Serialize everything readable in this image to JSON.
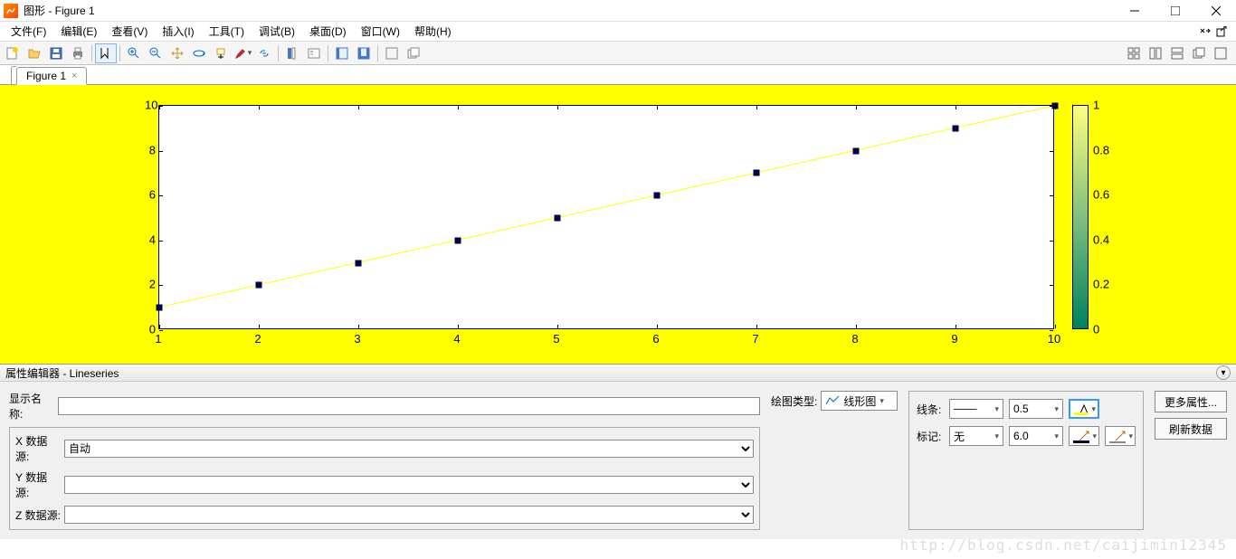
{
  "window": {
    "title": "图形 - Figure 1"
  },
  "menu": {
    "file": "文件(F)",
    "edit": "编辑(E)",
    "view": "查看(V)",
    "insert": "插入(I)",
    "tools": "工具(T)",
    "debug": "调试(B)",
    "desktop": "桌面(D)",
    "window": "窗口(W)",
    "help": "帮助(H)"
  },
  "tab": {
    "label": "Figure 1"
  },
  "prop_editor": {
    "title": "属性编辑器 - Lineseries",
    "display_name_label": "显示名称:",
    "display_name_value": "",
    "x_src_label": "X 数据源:",
    "x_src_value": "自动",
    "y_src_label": "Y 数据源:",
    "y_src_value": "",
    "z_src_label": "Z 数据源:",
    "z_src_value": "",
    "plot_type_label": "绘图类型:",
    "plot_type_value": "线形图",
    "line_label": "线条:",
    "line_style": "———",
    "line_width": "0.5",
    "marker_label": "标记:",
    "marker_style": "无",
    "marker_size": "6.0",
    "more_props": "更多属性...",
    "refresh": "刷新数据"
  },
  "watermark": "http://blog.csdn.net/caijimin12345",
  "chart_data": {
    "type": "line",
    "x": [
      1,
      2,
      3,
      4,
      5,
      6,
      7,
      8,
      9,
      10
    ],
    "y": [
      1,
      2,
      3,
      4,
      5,
      6,
      7,
      8,
      9,
      10
    ],
    "xlim": [
      1,
      10
    ],
    "ylim": [
      0,
      10
    ],
    "xticks": [
      1,
      2,
      3,
      4,
      5,
      6,
      7,
      8,
      9,
      10
    ],
    "yticks": [
      0,
      2,
      4,
      6,
      8,
      10
    ],
    "line_color": "#ffff00",
    "marker": "square",
    "marker_color": "#00004d",
    "colorbar": {
      "range": [
        0,
        1
      ],
      "ticks": [
        0,
        0.2,
        0.4,
        0.6,
        0.8,
        1
      ]
    }
  }
}
